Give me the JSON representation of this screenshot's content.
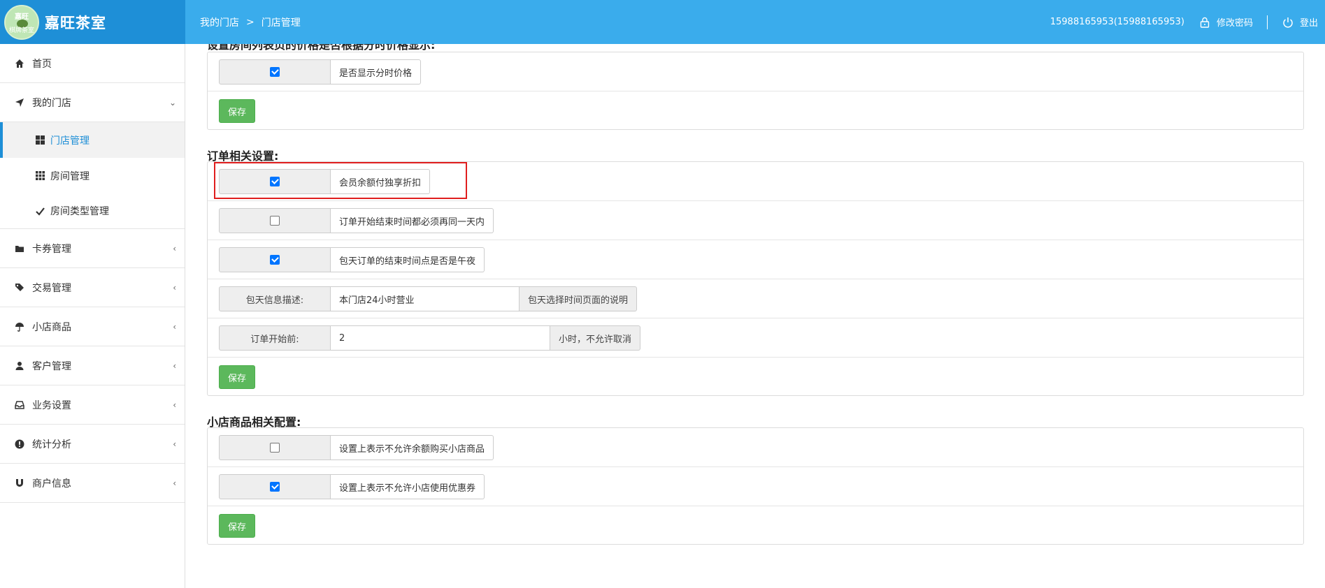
{
  "header": {
    "brand_title": "嘉旺茶室",
    "logo_text_top": "嘉旺",
    "logo_text_bottom": "棋牌茶室",
    "breadcrumb": [
      "我的门店",
      ">",
      "门店管理"
    ],
    "user": "15988165953(15988165953)",
    "change_password": "修改密码",
    "logout": "登出"
  },
  "sidebar": {
    "home": "首页",
    "my_store": "我的门店",
    "sub_items": [
      {
        "label": "门店管理",
        "icon": "th-large-icon"
      },
      {
        "label": "房间管理",
        "icon": "th-icon"
      },
      {
        "label": "房间类型管理",
        "icon": "check-icon"
      }
    ],
    "items": [
      {
        "label": "卡券管理",
        "icon": "folder-icon"
      },
      {
        "label": "交易管理",
        "icon": "tags-icon"
      },
      {
        "label": "小店商品",
        "icon": "umbrella-icon"
      },
      {
        "label": "客户管理",
        "icon": "user-icon"
      },
      {
        "label": "业务设置",
        "icon": "inbox-icon"
      },
      {
        "label": "统计分析",
        "icon": "exclamation-icon"
      },
      {
        "label": "商户信息",
        "icon": "magnet-icon"
      }
    ]
  },
  "sections": {
    "top_cut_title": "设置房间列表页的价格是否根据分时价格显示:",
    "top_row_label": "是否显示分时价格",
    "top_row_checked": true,
    "order_title": "订单相关设置:",
    "order_rows": [
      {
        "label": "会员余额付独享折扣",
        "checked": true
      },
      {
        "label": "订单开始结束时间都必须再同一天内",
        "checked": false
      },
      {
        "label": "包天订单的结束时间点是否是午夜",
        "checked": true
      }
    ],
    "daily_desc_addon": "包天信息描述:",
    "daily_desc_value": "本门店24小时营业",
    "daily_desc_suffix": "包天选择时间页面的说明",
    "order_before_addon": "订单开始前:",
    "order_before_value": "2",
    "order_before_suffix": "小时，不允许取消",
    "shop_title": "小店商品相关配置:",
    "shop_rows": [
      {
        "label": "设置上表示不允许余额购买小店商品",
        "checked": false
      },
      {
        "label": "设置上表示不允许小店使用优惠券",
        "checked": true
      }
    ],
    "save_label": "保存"
  },
  "colors": {
    "header": "#3aacec",
    "brand": "#1e8fd7",
    "save_button": "#5cb85c",
    "highlight": "#e01e1e"
  }
}
